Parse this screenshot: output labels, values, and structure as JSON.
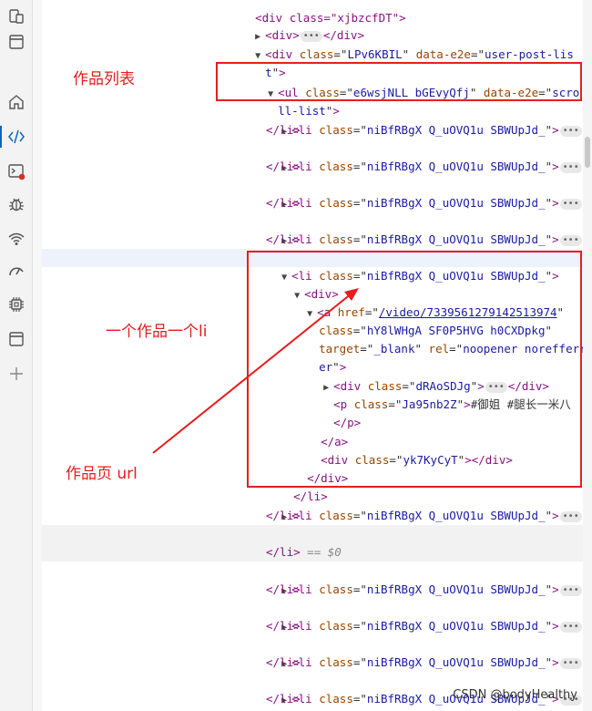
{
  "annotations": {
    "works_list": "作品列表",
    "one_li": "一个作品一个li",
    "work_url": "作品页 url"
  },
  "watermark": "CSDN @bodyHealthy",
  "colors": {
    "annotation": "#e51e1e",
    "tag": "#881280",
    "attr": "#994500",
    "value": "#1a1aa6"
  },
  "activity_icons": [
    "device-toggle-icon",
    "window-icon",
    "home-icon",
    "elements-icon",
    "console-icon",
    "bug-icon",
    "network-icon",
    "performance-icon",
    "memory-icon",
    "application-icon",
    "add-icon"
  ],
  "dom": {
    "top_div_partial": "<div class=\"xjbzcfDT\">",
    "div_collapsed": "<div>",
    "div_close": "</div>",
    "post_list_div_open": "<div",
    "post_list_class_attr": "class",
    "post_list_class": "LPv6KBIL",
    "post_list_e2e_attr": "data-e2e",
    "post_list_e2e_1": "user-post-lis",
    "post_list_e2e_2": "t",
    "post_list_close": ">",
    "ul_tag": "<ul",
    "ul_class": "e6wsjNLL bGEvyQfj",
    "ul_e2e_1": "scro",
    "ul_e2e_2": "ll-list",
    "li_tag": "<li",
    "li_class": "niBfRBgX Q_uOVQ1u SBWUpJd_",
    "li_close": "</li>",
    "li_dollar": "== $0",
    "div_open_tag": "<div>",
    "a_tag": "<a",
    "href_attr": "href",
    "href_value": "/video/7339561279142513974",
    "a_class_attr": "class",
    "a_class": "hY8lWHgA SF0P5HVG h0CXDpkg",
    "target_attr": "target",
    "target_value": "_blank",
    "rel_attr": "rel",
    "rel_value_1": "noopener norefferr",
    "rel_value_2": "er",
    "inner_div_class": "dRAoSDJg",
    "p_tag": "<p",
    "p_class": "Ja95nb2Z",
    "p_text": "#御姐 #腿长一米八",
    "p_close": "</p>",
    "a_close": "</a>",
    "yk_class": "yk7KyCyT",
    "gutter_ellipsis": "..."
  }
}
